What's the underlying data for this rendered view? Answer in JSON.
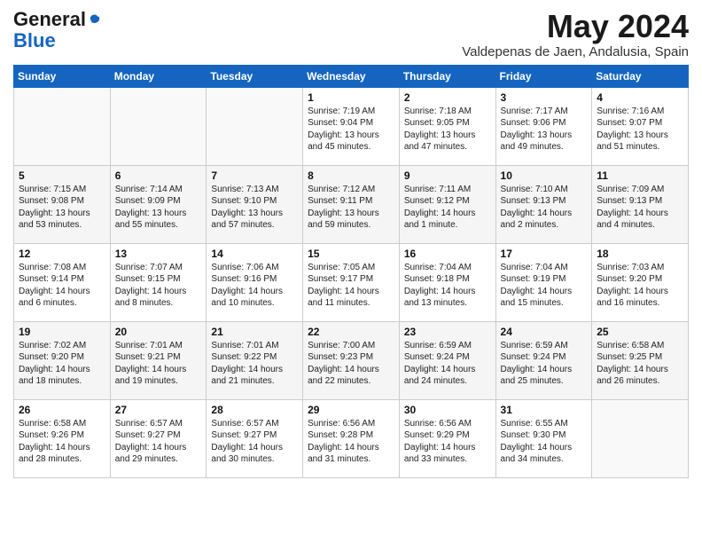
{
  "header": {
    "logo_general": "General",
    "logo_blue": "Blue",
    "month": "May 2024",
    "location": "Valdepenas de Jaen, Andalusia, Spain"
  },
  "weekdays": [
    "Sunday",
    "Monday",
    "Tuesday",
    "Wednesday",
    "Thursday",
    "Friday",
    "Saturday"
  ],
  "rows": [
    [
      {
        "day": "",
        "info": ""
      },
      {
        "day": "",
        "info": ""
      },
      {
        "day": "",
        "info": ""
      },
      {
        "day": "1",
        "info": "Sunrise: 7:19 AM\nSunset: 9:04 PM\nDaylight: 13 hours\nand 45 minutes."
      },
      {
        "day": "2",
        "info": "Sunrise: 7:18 AM\nSunset: 9:05 PM\nDaylight: 13 hours\nand 47 minutes."
      },
      {
        "day": "3",
        "info": "Sunrise: 7:17 AM\nSunset: 9:06 PM\nDaylight: 13 hours\nand 49 minutes."
      },
      {
        "day": "4",
        "info": "Sunrise: 7:16 AM\nSunset: 9:07 PM\nDaylight: 13 hours\nand 51 minutes."
      }
    ],
    [
      {
        "day": "5",
        "info": "Sunrise: 7:15 AM\nSunset: 9:08 PM\nDaylight: 13 hours\nand 53 minutes."
      },
      {
        "day": "6",
        "info": "Sunrise: 7:14 AM\nSunset: 9:09 PM\nDaylight: 13 hours\nand 55 minutes."
      },
      {
        "day": "7",
        "info": "Sunrise: 7:13 AM\nSunset: 9:10 PM\nDaylight: 13 hours\nand 57 minutes."
      },
      {
        "day": "8",
        "info": "Sunrise: 7:12 AM\nSunset: 9:11 PM\nDaylight: 13 hours\nand 59 minutes."
      },
      {
        "day": "9",
        "info": "Sunrise: 7:11 AM\nSunset: 9:12 PM\nDaylight: 14 hours\nand 1 minute."
      },
      {
        "day": "10",
        "info": "Sunrise: 7:10 AM\nSunset: 9:13 PM\nDaylight: 14 hours\nand 2 minutes."
      },
      {
        "day": "11",
        "info": "Sunrise: 7:09 AM\nSunset: 9:13 PM\nDaylight: 14 hours\nand 4 minutes."
      }
    ],
    [
      {
        "day": "12",
        "info": "Sunrise: 7:08 AM\nSunset: 9:14 PM\nDaylight: 14 hours\nand 6 minutes."
      },
      {
        "day": "13",
        "info": "Sunrise: 7:07 AM\nSunset: 9:15 PM\nDaylight: 14 hours\nand 8 minutes."
      },
      {
        "day": "14",
        "info": "Sunrise: 7:06 AM\nSunset: 9:16 PM\nDaylight: 14 hours\nand 10 minutes."
      },
      {
        "day": "15",
        "info": "Sunrise: 7:05 AM\nSunset: 9:17 PM\nDaylight: 14 hours\nand 11 minutes."
      },
      {
        "day": "16",
        "info": "Sunrise: 7:04 AM\nSunset: 9:18 PM\nDaylight: 14 hours\nand 13 minutes."
      },
      {
        "day": "17",
        "info": "Sunrise: 7:04 AM\nSunset: 9:19 PM\nDaylight: 14 hours\nand 15 minutes."
      },
      {
        "day": "18",
        "info": "Sunrise: 7:03 AM\nSunset: 9:20 PM\nDaylight: 14 hours\nand 16 minutes."
      }
    ],
    [
      {
        "day": "19",
        "info": "Sunrise: 7:02 AM\nSunset: 9:20 PM\nDaylight: 14 hours\nand 18 minutes."
      },
      {
        "day": "20",
        "info": "Sunrise: 7:01 AM\nSunset: 9:21 PM\nDaylight: 14 hours\nand 19 minutes."
      },
      {
        "day": "21",
        "info": "Sunrise: 7:01 AM\nSunset: 9:22 PM\nDaylight: 14 hours\nand 21 minutes."
      },
      {
        "day": "22",
        "info": "Sunrise: 7:00 AM\nSunset: 9:23 PM\nDaylight: 14 hours\nand 22 minutes."
      },
      {
        "day": "23",
        "info": "Sunrise: 6:59 AM\nSunset: 9:24 PM\nDaylight: 14 hours\nand 24 minutes."
      },
      {
        "day": "24",
        "info": "Sunrise: 6:59 AM\nSunset: 9:24 PM\nDaylight: 14 hours\nand 25 minutes."
      },
      {
        "day": "25",
        "info": "Sunrise: 6:58 AM\nSunset: 9:25 PM\nDaylight: 14 hours\nand 26 minutes."
      }
    ],
    [
      {
        "day": "26",
        "info": "Sunrise: 6:58 AM\nSunset: 9:26 PM\nDaylight: 14 hours\nand 28 minutes."
      },
      {
        "day": "27",
        "info": "Sunrise: 6:57 AM\nSunset: 9:27 PM\nDaylight: 14 hours\nand 29 minutes."
      },
      {
        "day": "28",
        "info": "Sunrise: 6:57 AM\nSunset: 9:27 PM\nDaylight: 14 hours\nand 30 minutes."
      },
      {
        "day": "29",
        "info": "Sunrise: 6:56 AM\nSunset: 9:28 PM\nDaylight: 14 hours\nand 31 minutes."
      },
      {
        "day": "30",
        "info": "Sunrise: 6:56 AM\nSunset: 9:29 PM\nDaylight: 14 hours\nand 33 minutes."
      },
      {
        "day": "31",
        "info": "Sunrise: 6:55 AM\nSunset: 9:30 PM\nDaylight: 14 hours\nand 34 minutes."
      },
      {
        "day": "",
        "info": ""
      }
    ]
  ]
}
